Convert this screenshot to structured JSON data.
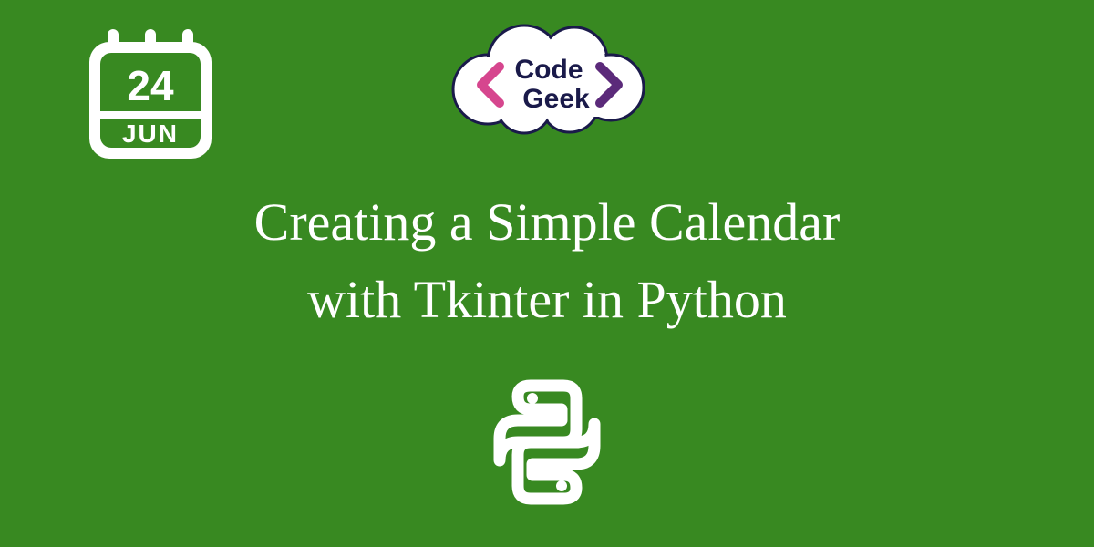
{
  "calendar": {
    "day": "24",
    "month": "JUN"
  },
  "logo": {
    "line1": "Code",
    "line2": "Geek"
  },
  "title": {
    "line1": "Creating a Simple Calendar",
    "line2": "with Tkinter in Python"
  },
  "colors": {
    "background": "#388921",
    "foreground": "#ffffff",
    "logo_purple": "#5b2a7a",
    "logo_pink": "#d6468e"
  }
}
